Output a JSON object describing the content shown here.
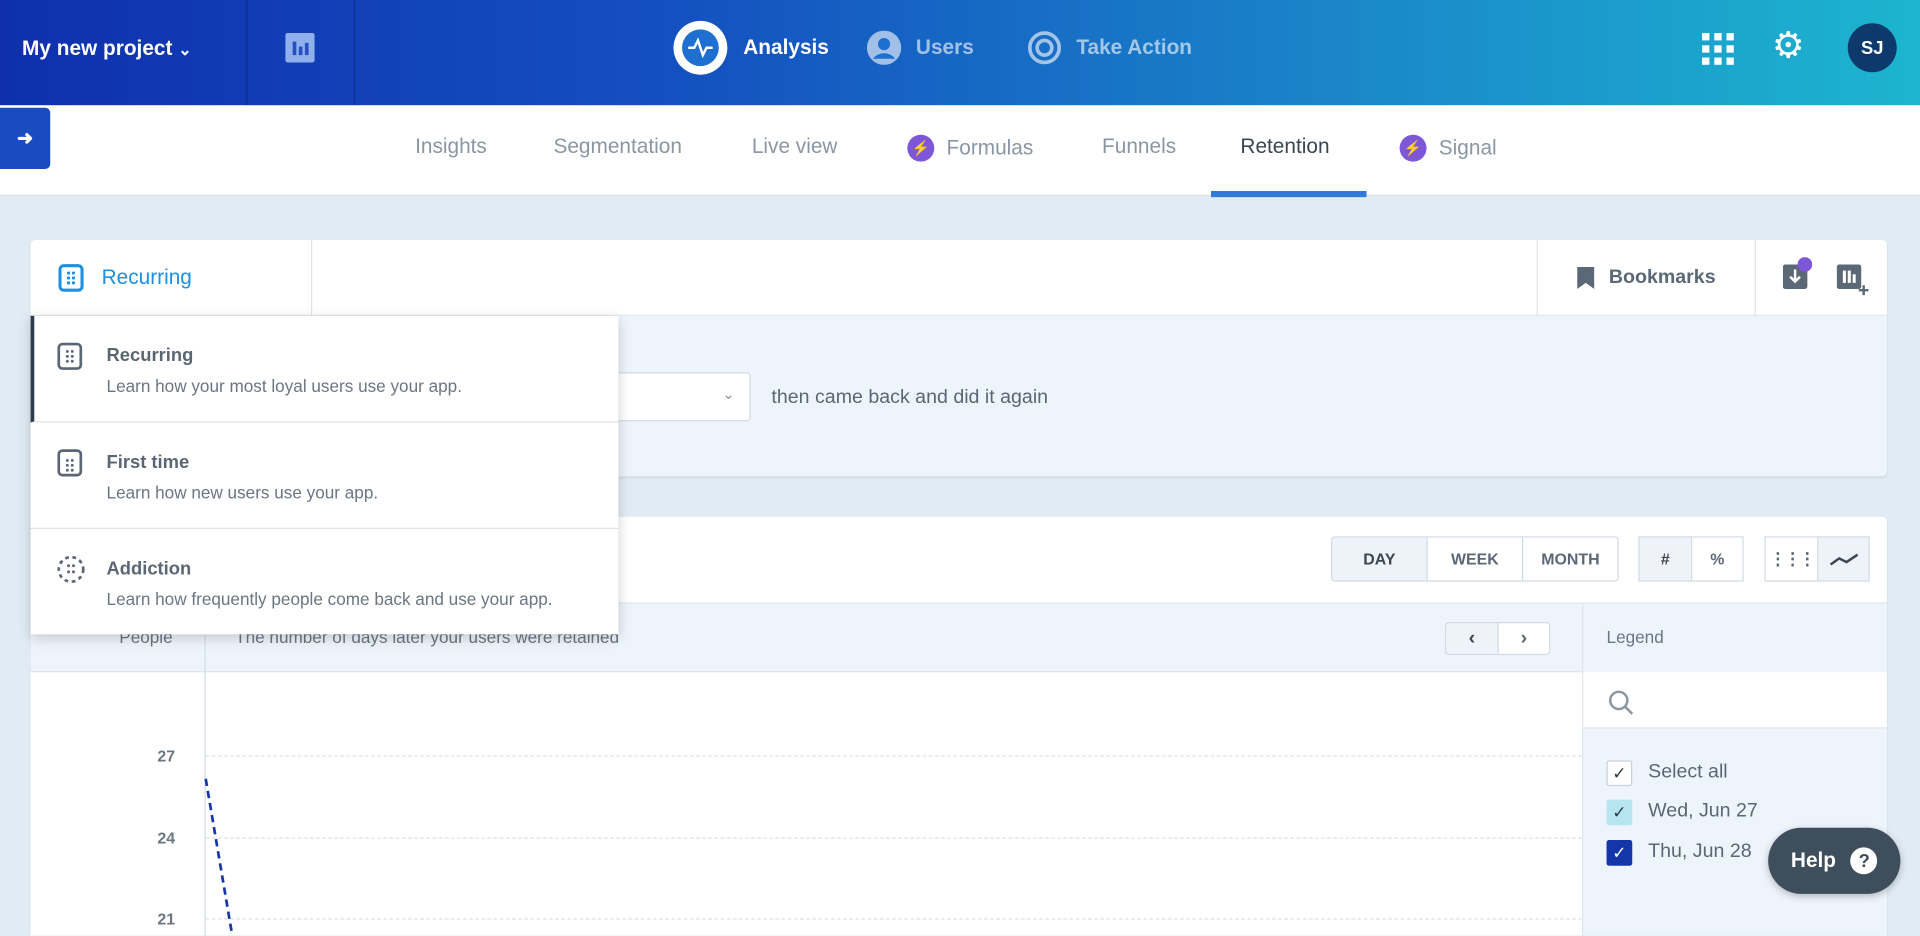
{
  "header": {
    "project": "My new project",
    "nav": [
      {
        "label": "Analysis",
        "icon": "pulse-icon",
        "active": true
      },
      {
        "label": "Users",
        "icon": "user-icon"
      },
      {
        "label": "Take Action",
        "icon": "target-icon"
      }
    ],
    "avatar": "SJ"
  },
  "subnav": {
    "tabs": [
      {
        "label": "Insights"
      },
      {
        "label": "Segmentation"
      },
      {
        "label": "Live view"
      },
      {
        "label": "Formulas",
        "badge": "lightning-icon"
      },
      {
        "label": "Funnels"
      },
      {
        "label": "Retention",
        "active": true
      },
      {
        "label": "Signal",
        "badge": "lightning-icon"
      }
    ]
  },
  "query": {
    "type_label": "Recurring",
    "bookmarks": "Bookmarks",
    "then_text": "then came back and did it again"
  },
  "menu": {
    "items": [
      {
        "title": "Recurring",
        "desc": "Learn how your most loyal users use your app.",
        "active": true
      },
      {
        "title": "First time",
        "desc": "Learn how new users use your app."
      },
      {
        "title": "Addiction",
        "desc": "Learn how frequently people come back and use your app."
      }
    ]
  },
  "toolbar": {
    "period": [
      "DAY",
      "WEEK",
      "MONTH"
    ],
    "selected_period": "DAY",
    "units": [
      "#",
      "%"
    ],
    "selected_unit": "#"
  },
  "table": {
    "people_header": "People",
    "days_header": "The number of days later your users were retained",
    "legend_header": "Legend"
  },
  "chart_data": {
    "type": "line",
    "y_ticks": [
      27,
      24,
      21
    ],
    "series": [
      {
        "name": "Thu, Jun 28",
        "color": "#1536a8",
        "style": "dashed"
      }
    ]
  },
  "legend": {
    "search_placeholder": "",
    "items": [
      {
        "label": "Select all",
        "checked": true,
        "color": "#ffffff"
      },
      {
        "label": "Wed, Jun 27",
        "checked": true,
        "color": "#b5e6f0"
      },
      {
        "label": "Thu, Jun 28",
        "checked": true,
        "color": "#1536a8"
      }
    ]
  },
  "help": "Help",
  "colors": {
    "accent": "#2f7ad8",
    "brand": "#1536a8",
    "purple": "#7e57d9"
  }
}
